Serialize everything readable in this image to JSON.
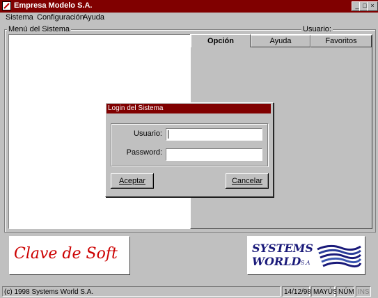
{
  "window": {
    "title": "Empresa Modelo S.A.",
    "min_label": "_",
    "max_label": "□",
    "close_label": "×"
  },
  "menu": [
    {
      "label": "Sistema"
    },
    {
      "label": "Configuración"
    },
    {
      "label": "Ayuda"
    }
  ],
  "group": {
    "label": "Menú del Sistema",
    "user_label": "Usuario:"
  },
  "tabs": [
    {
      "label": "Opción"
    },
    {
      "label": "Ayuda"
    },
    {
      "label": "Favoritos"
    }
  ],
  "dialog": {
    "title": "Login del Sistema",
    "user_label": "Usuario:",
    "user_value": "",
    "password_label": "Password:",
    "password_value": "",
    "accept_label": "Aceptar",
    "cancel_label": "Cancelar"
  },
  "logos": {
    "left_text": "Clave de Soft",
    "right_text_line1": "SYSTEMS",
    "right_text_line2": "WORLD",
    "right_suffix": "S.A"
  },
  "status": {
    "copyright": "(c) 1998 Systems World S.A.",
    "date": "14/12/98",
    "caps": "MAYÚS",
    "num": "NÚM",
    "ins": "INS"
  },
  "colors": {
    "titlebar": "#800000",
    "face": "#c0c0c0",
    "logo_red": "#cc0000",
    "logo_blue": "#1a1a7a"
  }
}
